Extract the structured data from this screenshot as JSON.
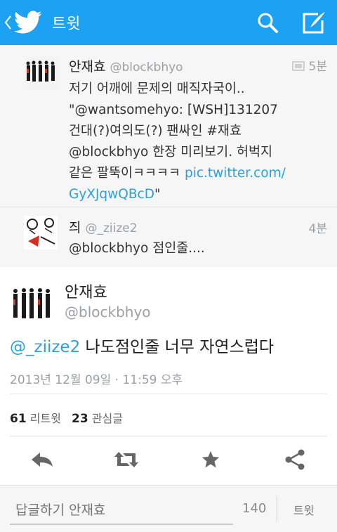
{
  "header": {
    "title": "트윗"
  },
  "tweets": [
    {
      "name": "안재효",
      "handle": "@blockbhyo",
      "time": "5분",
      "body": {
        "line1": "저기 어깨에 문제의 매직자국이..",
        "line2": "\"@wantsomehyo: [WSH]131207",
        "line3": "건대(?)여의도(?) 팬싸인 #재효",
        "line4": "@blockbhyo 한장 미리보기. 허벅지",
        "line5_text": "같은 팔뚝이ㅋㅋㅋㅋ ",
        "line5_link": "pic.twitter.com/",
        "line6_link": "GyXJqwQBcD",
        "line6_tail": "\""
      }
    },
    {
      "name": "즤",
      "handle": "@_ziize2",
      "time": "4분",
      "body": {
        "line1": "@blockbhyo 점인줄...."
      }
    }
  ],
  "main_tweet": {
    "name": "안재효",
    "handle": "@blockbhyo",
    "mention": "@_ziize2",
    "text": " 나도점인줄 너무 자연스럽다",
    "date": "2013년 12월 09일 · 11:59 오후",
    "retweets_count": "61",
    "retweets_label": "리트윗",
    "favorites_count": "23",
    "favorites_label": "관심글"
  },
  "reply": {
    "placeholder": "답글하기 안재효",
    "counter": "140",
    "send_label": "트윗"
  },
  "colors": {
    "brand": "#1da1f2",
    "link": "#2b9fe0"
  }
}
